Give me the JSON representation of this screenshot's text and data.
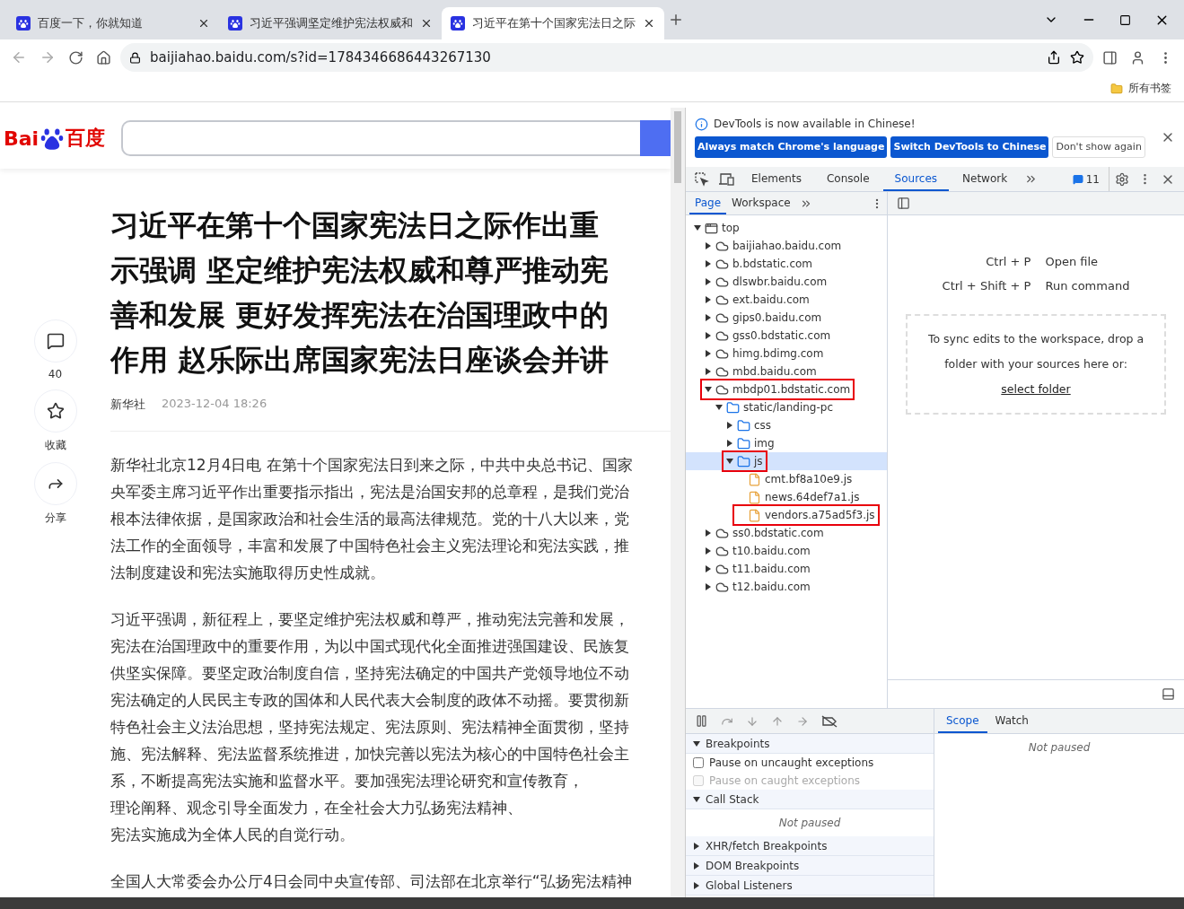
{
  "browser": {
    "tabs": [
      {
        "title": "百度一下，你就知道",
        "selected": false
      },
      {
        "title": "习近平强调坚定维护宪法权威和",
        "selected": false
      },
      {
        "title": "习近平在第十个国家宪法日之际",
        "selected": true
      }
    ],
    "url": "baijiahao.baidu.com/s?id=1784346686443267130",
    "bookmarks_label": "所有书签"
  },
  "page": {
    "logo": {
      "latin": "Bai",
      "chinese": "百度"
    },
    "actions": [
      {
        "kind": "comment",
        "label": "40"
      },
      {
        "kind": "favorite",
        "label": "收藏"
      },
      {
        "kind": "share",
        "label": "分享"
      }
    ],
    "title_lines": [
      "习近平在第十个国家宪法日之际作出重",
      "示强调 坚定维护宪法权威和尊严推动宪",
      "善和发展 更好发挥宪法在治国理政中的",
      "作用 赵乐际出席国家宪法日座谈会并讲"
    ],
    "source": "新华社",
    "time": "2023-12-04 18:26",
    "paragraphs": [
      [
        "新华社北京12月4日电 在第十个国家宪法日到来之际，中共中央总书记、国家",
        "央军委主席习近平作出重要指示指出，宪法是治国安邦的总章程，是我们党治",
        "根本法律依据，是国家政治和社会生活的最高法律规范。党的十八大以来，党",
        "法工作的全面领导，丰富和发展了中国特色社会主义宪法理论和宪法实践，推",
        "法制度建设和宪法实施取得历史性成就。"
      ],
      [
        "习近平强调，新征程上，要坚定维护宪法权威和尊严，推动宪法完善和发展，",
        "宪法在治国理政中的重要作用，为以中国式现代化全面推进强国建设、民族复",
        "供坚实保障。要坚定政治制度自信，坚持宪法确定的中国共产党领导地位不动",
        "宪法确定的人民民主专政的国体和人民代表大会制度的政体不动摇。要贯彻新",
        "特色社会主义法治思想，坚持宪法规定、宪法原则、宪法精神全面贯彻，坚持",
        "施、宪法解释、宪法监督系统推进，加快完善以宪法为核心的中国特色社会主",
        "系，不断提高宪法实施和监督水平。要加强宪法理论研究和宣传教育，",
        "理论阐释、观念引导全面发力，在全社会大力弘扬宪法精神、",
        "宪法实施成为全体人民的自觉行动。"
      ],
      [
        "全国人大常委会办公厅4日会同中央宣传部、司法部在北京举行“弘扬宪法精神"
      ]
    ]
  },
  "devtools": {
    "banner": {
      "message": "DevTools is now available in Chinese!",
      "buttons": [
        {
          "label": "Always match Chrome's language",
          "kind": "primary"
        },
        {
          "label": "Switch DevTools to Chinese",
          "kind": "primary"
        },
        {
          "label": "Don't show again",
          "kind": "secondary"
        }
      ]
    },
    "tabs": [
      {
        "label": "Elements",
        "selected": false
      },
      {
        "label": "Console",
        "selected": false
      },
      {
        "label": "Sources",
        "selected": true
      },
      {
        "label": "Network",
        "selected": false
      }
    ],
    "issues_count": "11",
    "navigator_tabs": [
      {
        "label": "Page",
        "selected": true
      },
      {
        "label": "Workspace",
        "selected": false
      }
    ],
    "tree": [
      {
        "label": "top",
        "kind": "frame",
        "expanded": true,
        "selected": false,
        "highlighted": false,
        "children": [
          {
            "label": "baijiahao.baidu.com",
            "kind": "domain",
            "expanded": false,
            "selected": false,
            "highlighted": false
          },
          {
            "label": "b.bdstatic.com",
            "kind": "domain",
            "expanded": false,
            "selected": false,
            "highlighted": false
          },
          {
            "label": "dlswbr.baidu.com",
            "kind": "domain",
            "expanded": false,
            "selected": false,
            "highlighted": false
          },
          {
            "label": "ext.baidu.com",
            "kind": "domain",
            "expanded": false,
            "selected": false,
            "highlighted": false
          },
          {
            "label": "gips0.baidu.com",
            "kind": "domain",
            "expanded": false,
            "selected": false,
            "highlighted": false
          },
          {
            "label": "gss0.bdstatic.com",
            "kind": "domain",
            "expanded": false,
            "selected": false,
            "highlighted": false
          },
          {
            "label": "himg.bdimg.com",
            "kind": "domain",
            "expanded": false,
            "selected": false,
            "highlighted": false
          },
          {
            "label": "mbd.baidu.com",
            "kind": "domain",
            "expanded": false,
            "selected": false,
            "highlighted": false
          },
          {
            "label": "mbdp01.bdstatic.com",
            "kind": "domain",
            "expanded": true,
            "selected": false,
            "highlighted": true,
            "children": [
              {
                "label": "static/landing-pc",
                "kind": "folder",
                "expanded": true,
                "selected": false,
                "highlighted": false,
                "children": [
                  {
                    "label": "css",
                    "kind": "folder",
                    "expanded": false,
                    "selected": false,
                    "highlighted": false
                  },
                  {
                    "label": "img",
                    "kind": "folder",
                    "expanded": false,
                    "selected": false,
                    "highlighted": false
                  },
                  {
                    "label": "js",
                    "kind": "folder",
                    "expanded": true,
                    "selected": true,
                    "highlighted": true,
                    "children": [
                      {
                        "label": "cmt.bf8a10e9.js",
                        "kind": "file",
                        "selected": false,
                        "highlighted": false
                      },
                      {
                        "label": "news.64def7a1.js",
                        "kind": "file",
                        "selected": false,
                        "highlighted": false
                      },
                      {
                        "label": "vendors.a75ad5f3.js",
                        "kind": "file",
                        "selected": false,
                        "highlighted": true
                      }
                    ]
                  }
                ]
              }
            ]
          },
          {
            "label": "ss0.bdstatic.com",
            "kind": "domain",
            "expanded": false,
            "selected": false,
            "highlighted": false
          },
          {
            "label": "t10.baidu.com",
            "kind": "domain",
            "expanded": false,
            "selected": false,
            "highlighted": false
          },
          {
            "label": "t11.baidu.com",
            "kind": "domain",
            "expanded": false,
            "selected": false,
            "highlighted": false
          },
          {
            "label": "t12.baidu.com",
            "kind": "domain",
            "expanded": false,
            "selected": false,
            "highlighted": false
          }
        ]
      }
    ],
    "shortcuts": [
      {
        "keys": "Ctrl + P",
        "action": "Open file"
      },
      {
        "keys": "Ctrl + Shift + P",
        "action": "Run command"
      }
    ],
    "workspace_hint": "To sync edits to the workspace, drop a folder with your sources here or:",
    "workspace_link": "select folder",
    "debugger_sections": [
      {
        "title": "Breakpoints",
        "expanded": true,
        "items": [
          {
            "label": "Pause on uncaught exceptions",
            "checked": false,
            "disabled": false
          },
          {
            "label": "Pause on caught exceptions",
            "checked": false,
            "disabled": true
          }
        ]
      },
      {
        "title": "Call Stack",
        "expanded": true,
        "note": "Not paused"
      },
      {
        "title": "XHR/fetch Breakpoints",
        "expanded": false
      },
      {
        "title": "DOM Breakpoints",
        "expanded": false
      },
      {
        "title": "Global Listeners",
        "expanded": false
      }
    ],
    "side_tabs": [
      {
        "label": "Scope",
        "selected": true
      },
      {
        "label": "Watch",
        "selected": false
      }
    ],
    "scope_note": "Not paused"
  }
}
